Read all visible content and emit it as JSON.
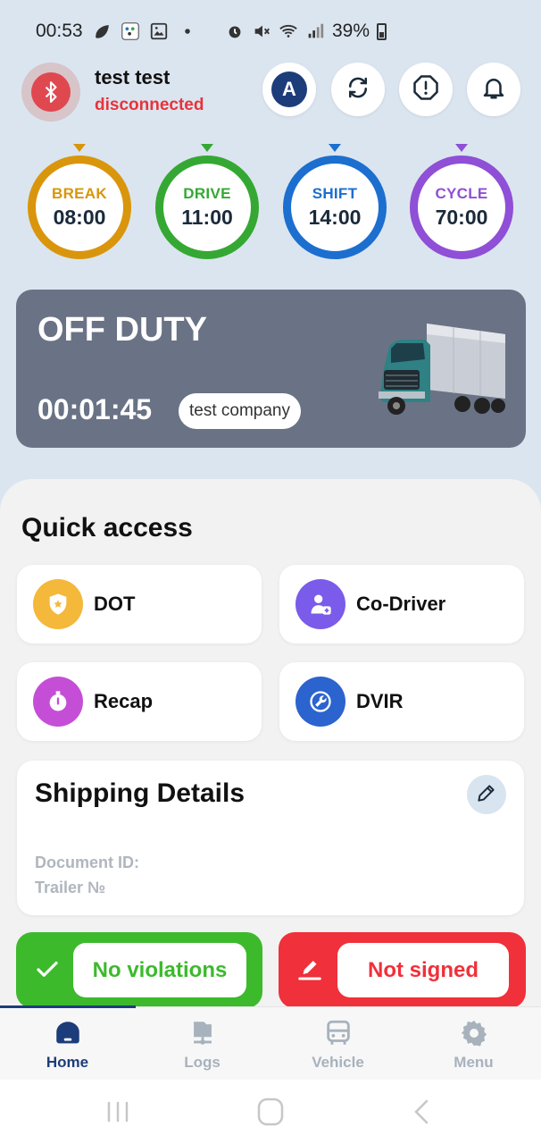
{
  "status_bar": {
    "time": "00:53",
    "battery": "39%",
    "icons_left": [
      "leaf-icon",
      "app-icon",
      "image-icon",
      "dot-icon"
    ],
    "icons_right": [
      "alarm-icon",
      "mute-icon",
      "wifi-icon",
      "signal-icon",
      "battery-icon"
    ]
  },
  "header": {
    "user_name": "test test",
    "connection_status": "disconnected",
    "avatar_letter": "A",
    "icons": [
      "bluetooth-icon",
      "sync-icon",
      "alert-icon",
      "bell-icon"
    ]
  },
  "timers": [
    {
      "label": "BREAK",
      "value": "08:00",
      "color": "#d9960c"
    },
    {
      "label": "DRIVE",
      "value": "11:00",
      "color": "#35a834"
    },
    {
      "label": "SHIFT",
      "value": "14:00",
      "color": "#1c6fcf"
    },
    {
      "label": "CYCLE",
      "value": "70:00",
      "color": "#8f4fd6"
    }
  ],
  "duty": {
    "status": "OFF DUTY",
    "time": "00:01:45",
    "company": "test company"
  },
  "quick_access": {
    "title": "Quick access",
    "items": [
      {
        "label": "DOT",
        "icon": "shield-icon",
        "color": "#f4b83a"
      },
      {
        "label": "Co-Driver",
        "icon": "add-user-icon",
        "color": "#7a5bea"
      },
      {
        "label": "Recap",
        "icon": "stopwatch-icon",
        "color": "#c44fd6"
      },
      {
        "label": "DVIR",
        "icon": "wrench-icon",
        "color": "#2b64cf"
      }
    ]
  },
  "shipping": {
    "title": "Shipping Details",
    "document_label": "Document ID:",
    "trailer_label": "Trailer №"
  },
  "status_boxes": {
    "violations": {
      "label": "No violations",
      "color": "#3cba2c"
    },
    "signed": {
      "label": "Not signed",
      "color": "#f0303a"
    }
  },
  "nav": [
    {
      "label": "Home",
      "active": true
    },
    {
      "label": "Logs",
      "active": false
    },
    {
      "label": "Vehicle",
      "active": false
    },
    {
      "label": "Menu",
      "active": false
    }
  ]
}
